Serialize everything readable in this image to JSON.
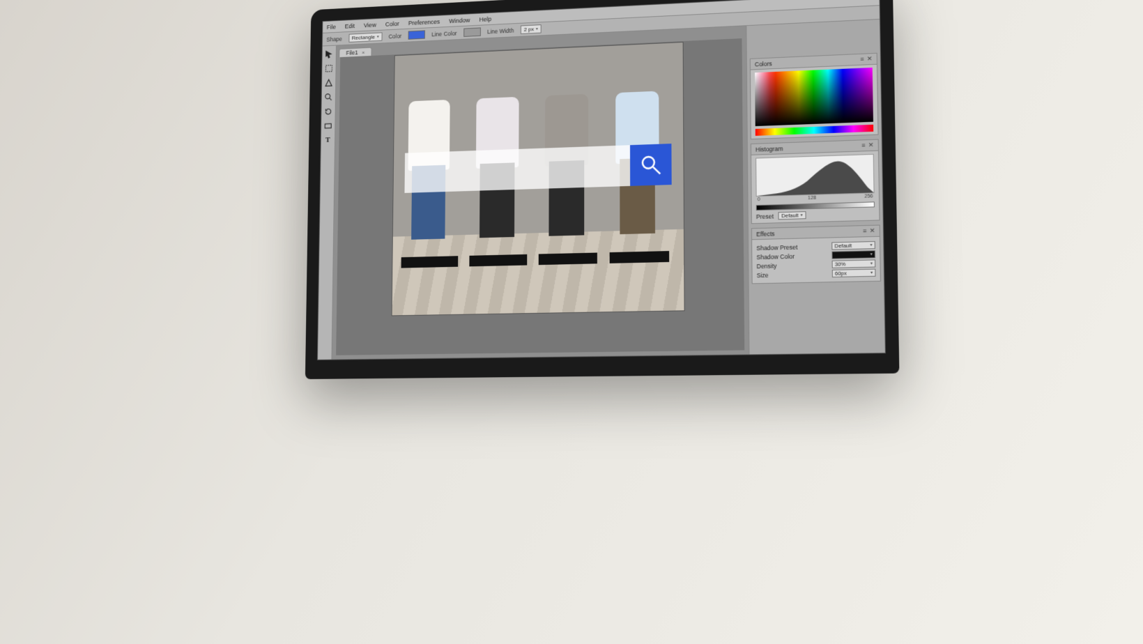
{
  "menu": {
    "items": [
      "File",
      "Edit",
      "View",
      "Color",
      "Preferences",
      "Window",
      "Help"
    ]
  },
  "options_bar": {
    "shape_label": "Shape",
    "shape_value": "Rectangle",
    "color_label": "Color",
    "color_value": "#3a63d8",
    "line_color_label": "Line Color",
    "line_color_value": "#9a9a9a",
    "line_width_label": "Line Width",
    "line_width_value": "2 px"
  },
  "tools": [
    {
      "name": "pointer-tool",
      "glyph": "pointer"
    },
    {
      "name": "marquee-tool",
      "glyph": "marquee"
    },
    {
      "name": "shape-tool",
      "glyph": "triangle"
    },
    {
      "name": "zoom-tool",
      "glyph": "zoom"
    },
    {
      "name": "rotate-tool",
      "glyph": "rotate"
    },
    {
      "name": "rectangle-tool",
      "glyph": "rect"
    },
    {
      "name": "text-tool",
      "glyph": "text"
    }
  ],
  "document": {
    "tab_label": "File1",
    "tab_close": "×"
  },
  "search_overlay": {
    "placeholder": "",
    "value": ""
  },
  "panels": {
    "colors": {
      "title": "Colors"
    },
    "histogram": {
      "title": "Histogram",
      "scale_min": "0",
      "scale_mid": "128",
      "scale_max": "256",
      "preset_label": "Preset",
      "preset_value": "Default"
    },
    "effects": {
      "title": "Effects",
      "rows": {
        "shadow_preset_label": "Shadow Preset",
        "shadow_preset_value": "Default",
        "shadow_color_label": "Shadow Color",
        "density_label": "Density",
        "density_value": "30%",
        "size_label": "Size",
        "size_value": "60px"
      }
    }
  },
  "window_controls": {
    "restore": "❐",
    "close": "✕"
  }
}
